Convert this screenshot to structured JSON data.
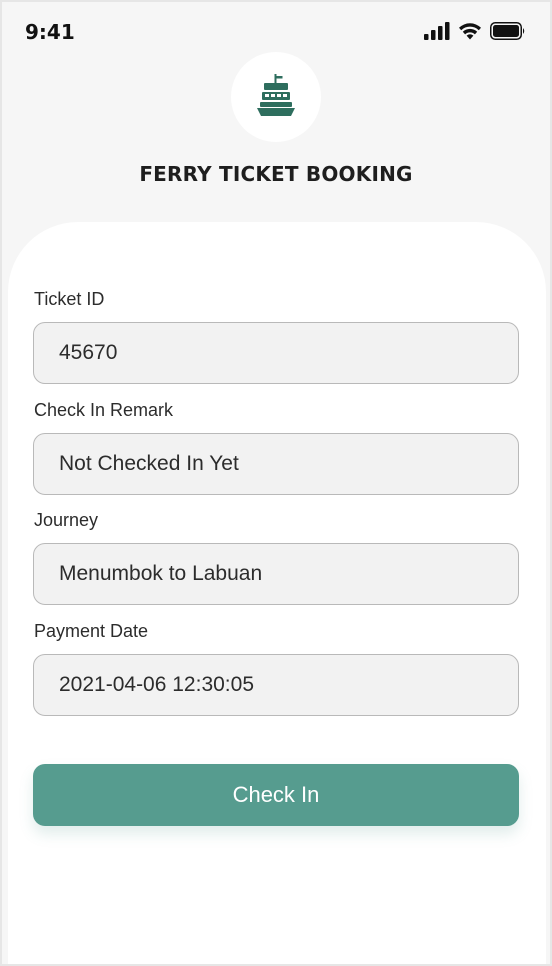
{
  "status_bar": {
    "time": "9:41",
    "icons": [
      "signal-icon",
      "wifi-icon",
      "battery-icon"
    ]
  },
  "header": {
    "logo_icon": "ferry-icon",
    "title": "FERRY TICKET BOOKING"
  },
  "form": {
    "fields": [
      {
        "label": "Ticket ID",
        "value": "45670"
      },
      {
        "label": "Check In Remark",
        "value": "Not Checked In Yet"
      },
      {
        "label": "Journey",
        "value": "Menumbok to Labuan"
      },
      {
        "label": "Payment Date",
        "value": "2021-04-06 12:30:05"
      }
    ]
  },
  "actions": {
    "check_in_label": "Check In"
  },
  "colors": {
    "accent": "#569c8f",
    "logo": "#2e6e5e",
    "background": "#f6f6f6",
    "field_background": "#f2f2f2"
  }
}
